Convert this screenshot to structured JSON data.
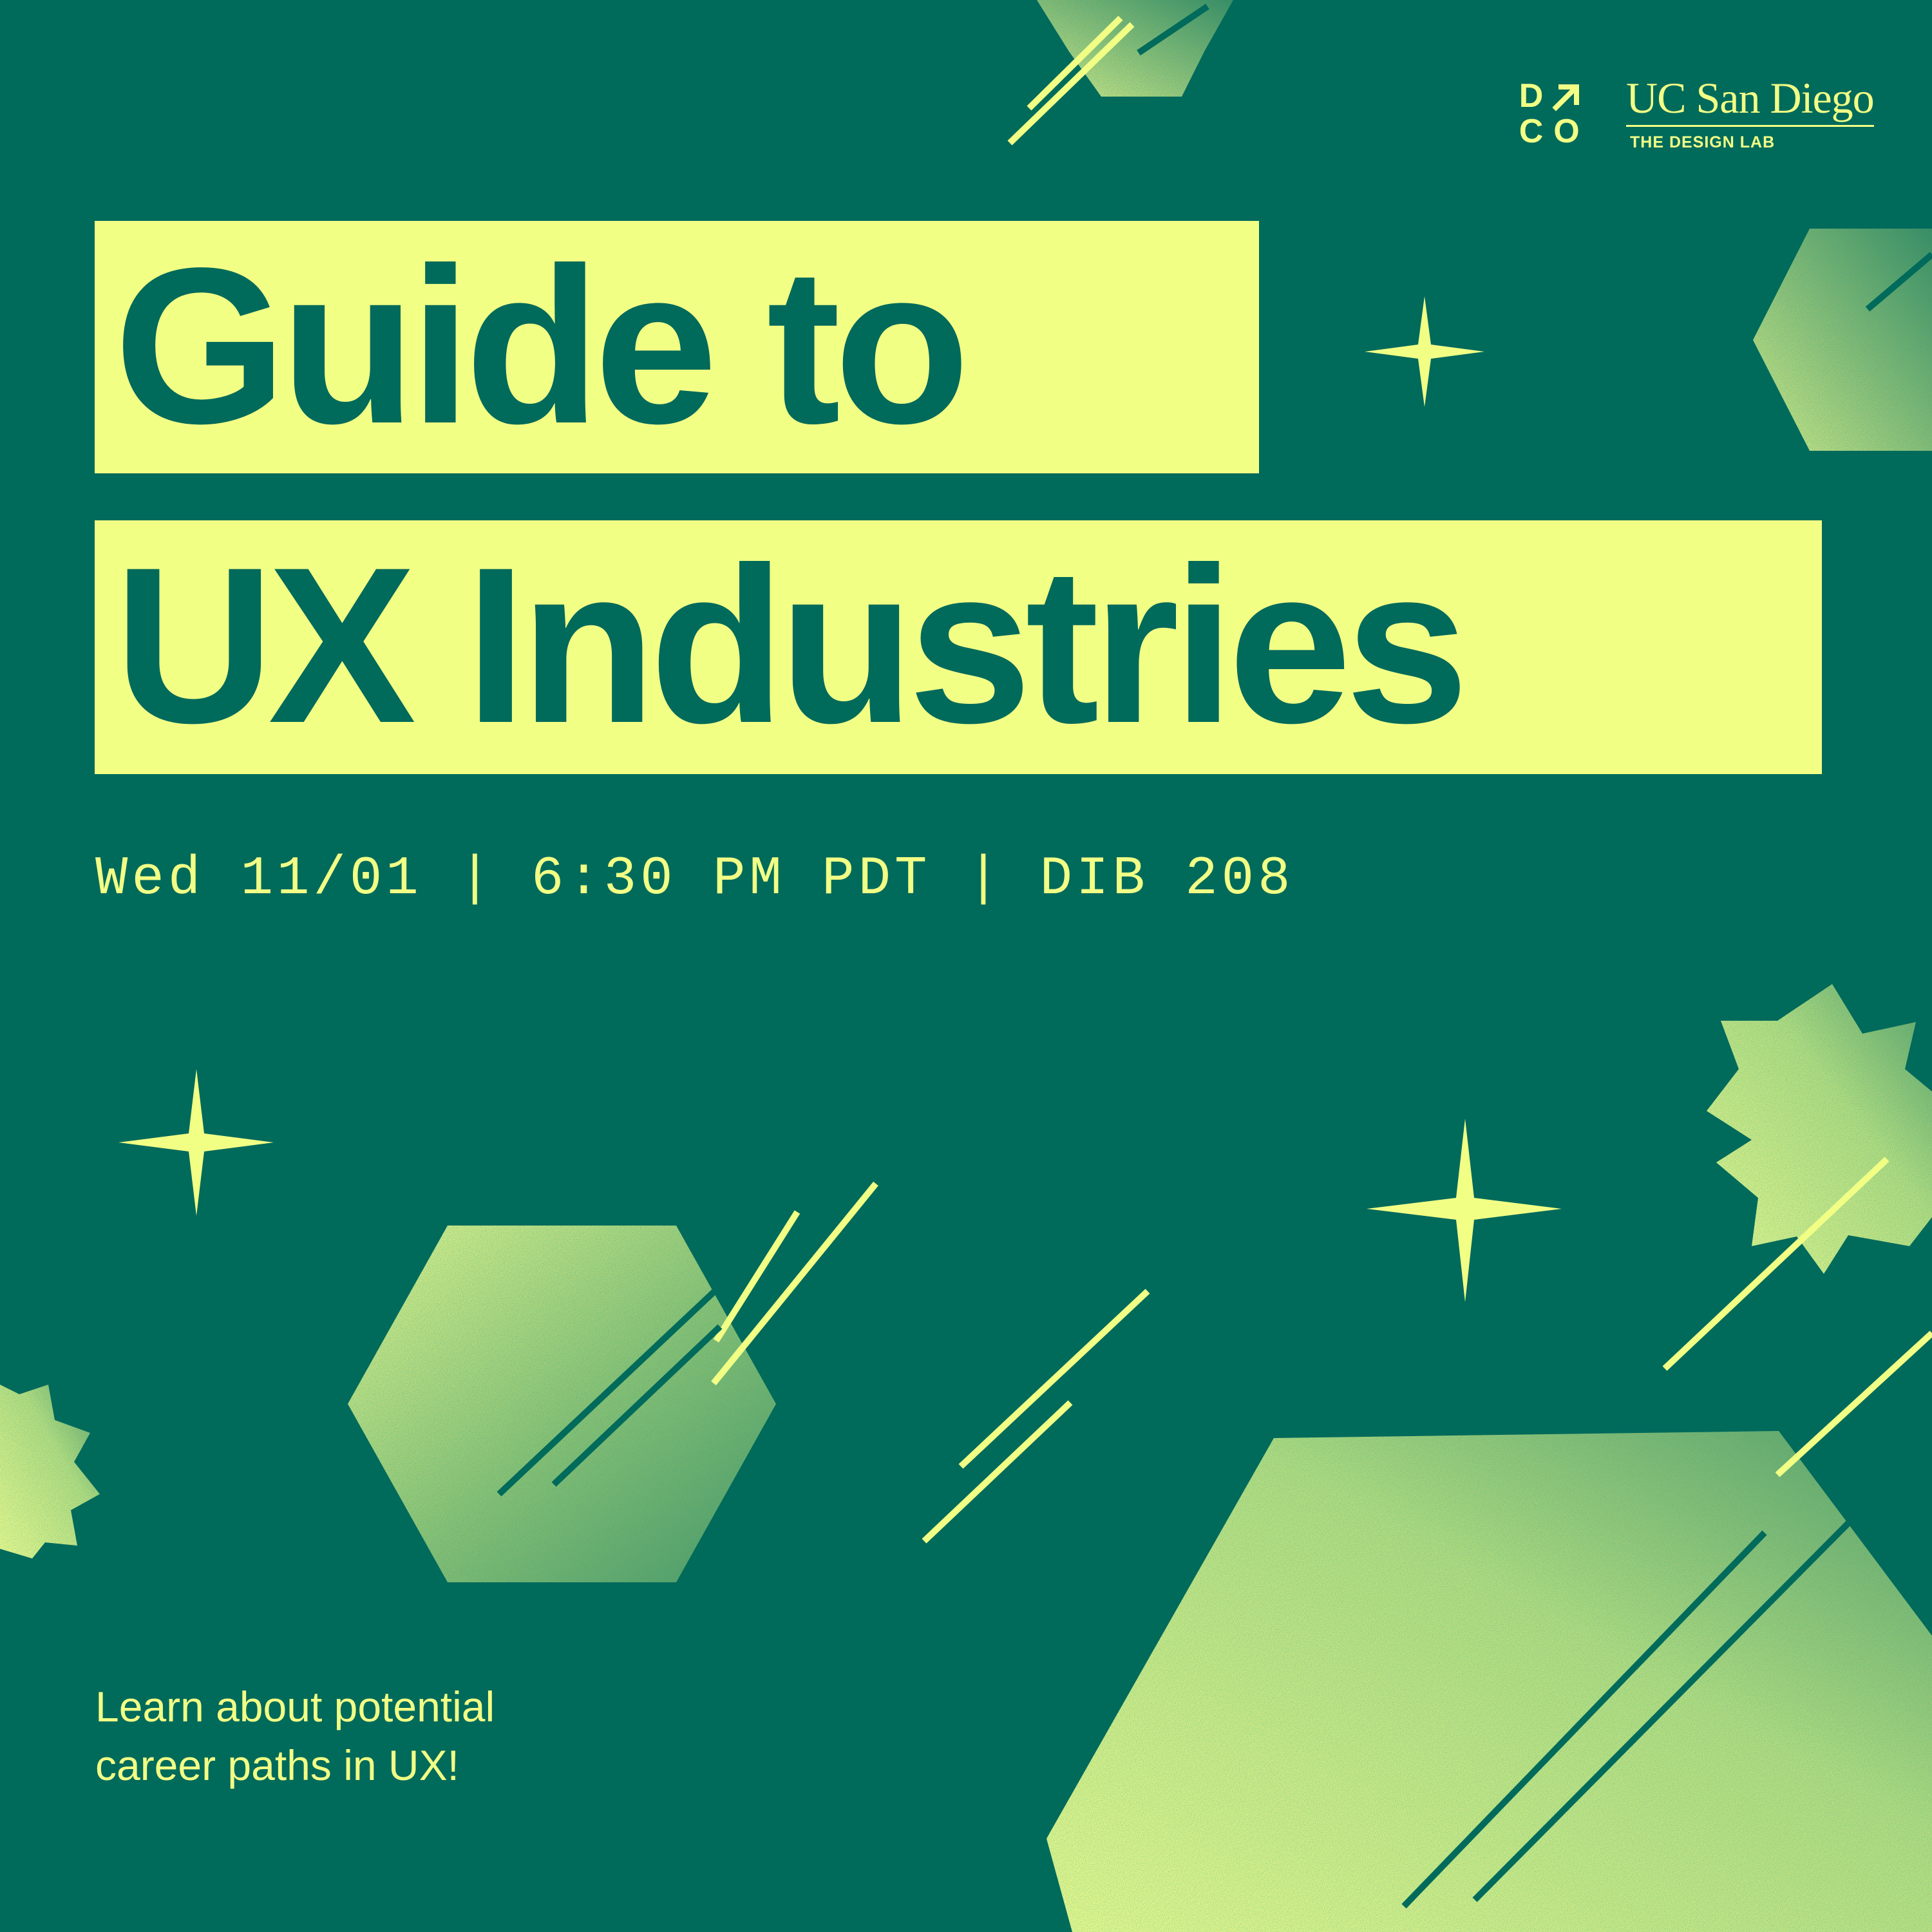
{
  "poster": {
    "title_line_1": "Guide to",
    "title_line_2": "UX Industries",
    "event_details": "Wed 11/01 | 6:30 PM PDT | DIB 208",
    "tagline_line_1": "Learn about potential",
    "tagline_line_2": "career paths in UX!"
  },
  "logos": {
    "dco": {
      "letters": [
        "D",
        "C",
        "O"
      ],
      "icon": "arrow-up-right-icon"
    },
    "ucsd": {
      "name": "UC San Diego",
      "subtitle": "THE DESIGN LAB"
    }
  },
  "colors": {
    "background": "#006a5b",
    "accent": "#f2ff85",
    "text_on_accent": "#006a5b"
  }
}
